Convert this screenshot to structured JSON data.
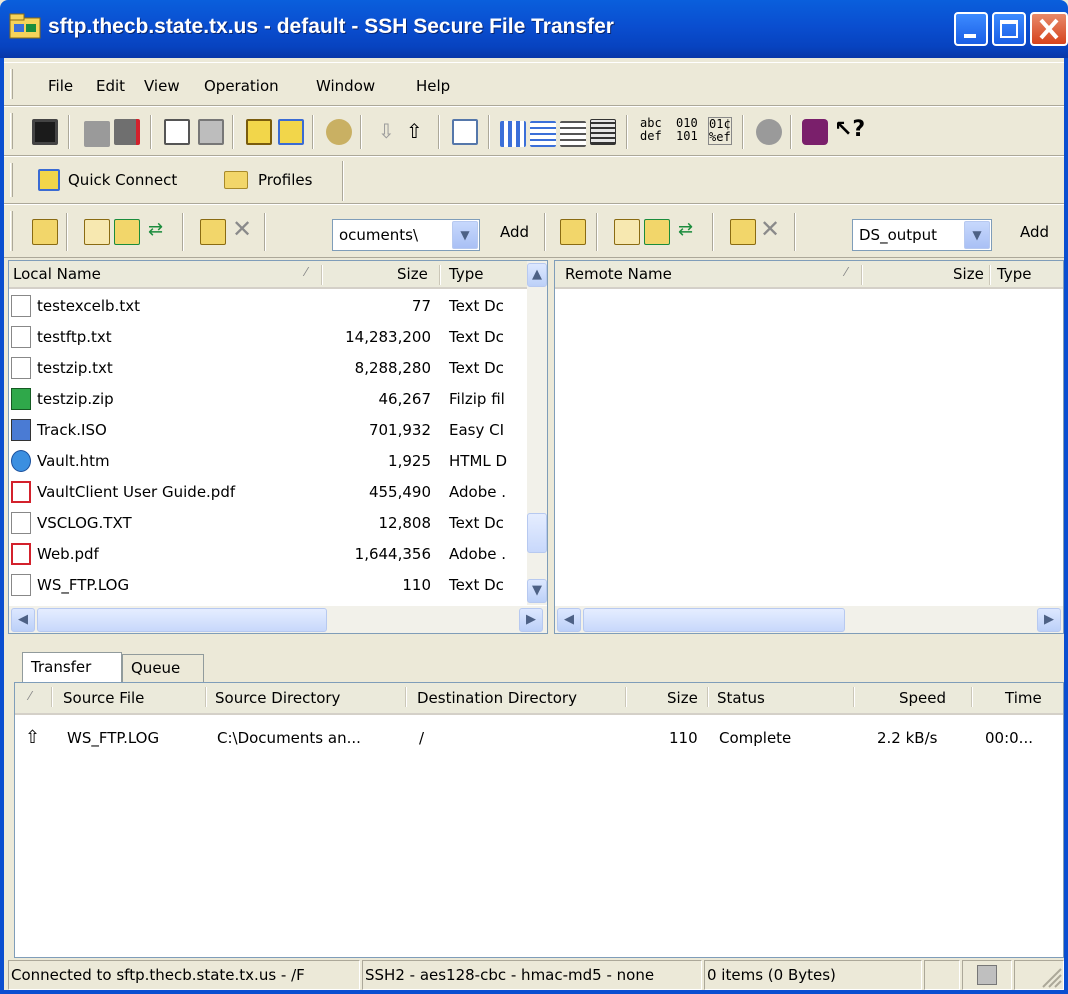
{
  "window": {
    "title": "sftp.thecb.state.tx.us - default - SSH Secure File Transfer"
  },
  "menu": [
    "File",
    "Edit",
    "View",
    "Operation",
    "Window",
    "Help"
  ],
  "quickbar": {
    "quick_connect": "Quick Connect",
    "profiles": "Profiles"
  },
  "local": {
    "path": "ocuments\\",
    "add": "Add",
    "columns": {
      "name": "Local Name",
      "size": "Size",
      "type": "Type"
    },
    "files": [
      {
        "name": "testexcelb.txt",
        "size": "77",
        "type": "Text Dc",
        "icon": "text-file-icon"
      },
      {
        "name": "testftp.txt",
        "size": "14,283,200",
        "type": "Text Dc",
        "icon": "text-file-icon"
      },
      {
        "name": "testzip.txt",
        "size": "8,288,280",
        "type": "Text Dc",
        "icon": "text-file-icon"
      },
      {
        "name": "testzip.zip",
        "size": "46,267",
        "type": "Filzip fil",
        "icon": "zip-file-icon"
      },
      {
        "name": "Track.ISO",
        "size": "701,932",
        "type": "Easy CI",
        "icon": "iso-file-icon"
      },
      {
        "name": "Vault.htm",
        "size": "1,925",
        "type": "HTML D",
        "icon": "html-file-icon"
      },
      {
        "name": "VaultClient User Guide.pdf",
        "size": "455,490",
        "type": "Adobe .",
        "icon": "pdf-file-icon"
      },
      {
        "name": "VSCLOG.TXT",
        "size": "12,808",
        "type": "Text Dc",
        "icon": "text-file-icon"
      },
      {
        "name": "Web.pdf",
        "size": "1,644,356",
        "type": "Adobe .",
        "icon": "pdf-file-icon"
      },
      {
        "name": "WS_FTP.LOG",
        "size": "110",
        "type": "Text Dc",
        "icon": "text-file-icon"
      }
    ]
  },
  "remote": {
    "path": "DS_output",
    "add": "Add",
    "columns": {
      "name": "Remote Name",
      "size": "Size",
      "type": "Type"
    }
  },
  "transfer": {
    "tabs": [
      "Transfer",
      "Queue"
    ],
    "columns": [
      "Source File",
      "Source Directory",
      "Destination Directory",
      "Size",
      "Status",
      "Speed",
      "Time"
    ],
    "rows": [
      {
        "file": "WS_FTP.LOG",
        "src": "C:\\Documents an...",
        "dst": "/",
        "size": "110",
        "status": "Complete",
        "speed": "2.2 kB/s",
        "time": "00:0..."
      }
    ]
  },
  "status": {
    "connection": "Connected to sftp.thecb.state.tx.us - /F",
    "cipher": "SSH2 - aes128-cbc - hmac-md5 - none",
    "items": "0 items (0 Bytes)"
  },
  "colors": {
    "titlebar": "#0a4ed0",
    "chrome": "#ece9d8",
    "scroll": "#c8d8fb"
  }
}
